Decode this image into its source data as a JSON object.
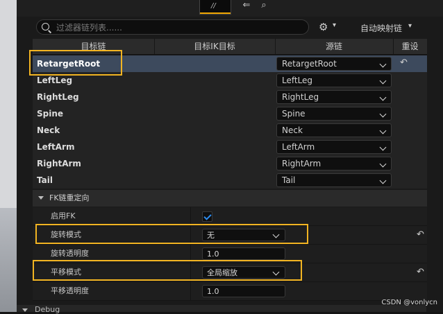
{
  "top": {
    "label": ""
  },
  "search": {
    "placeholder": "过滤器链列表......"
  },
  "toolbar": {
    "auto_map_label": "自动映射链"
  },
  "table": {
    "headers": [
      "目标链",
      "目标IK目标",
      "源链",
      "重设"
    ],
    "rows": [
      {
        "name": "RetargetRoot",
        "source": "RetargetRoot",
        "selected": true
      },
      {
        "name": "LeftLeg",
        "source": "LeftLeg"
      },
      {
        "name": "RightLeg",
        "source": "RightLeg"
      },
      {
        "name": "Spine",
        "source": "Spine"
      },
      {
        "name": "Neck",
        "source": "Neck"
      },
      {
        "name": "LeftArm",
        "source": "LeftArm"
      },
      {
        "name": "RightArm",
        "source": "RightArm"
      },
      {
        "name": "Tail",
        "source": "Tail"
      }
    ]
  },
  "fk_section": {
    "title": "FK链重定向",
    "enable_fk": {
      "label": "启用FK",
      "checked": true
    },
    "rotation_mode": {
      "label": "旋转模式",
      "value": "无"
    },
    "rotation_alpha": {
      "label": "旋转透明度",
      "value": "1.0"
    },
    "translation_mode": {
      "label": "平移模式",
      "value": "全局缩放"
    },
    "translation_alpha": {
      "label": "平移透明度",
      "value": "1.0"
    }
  },
  "debug": {
    "label": "Debug"
  },
  "watermark": "CSDN @vonlycn",
  "colors": {
    "highlight": "#f2b422",
    "selected_row": "#3d4a5d",
    "check": "#2d8df0"
  }
}
